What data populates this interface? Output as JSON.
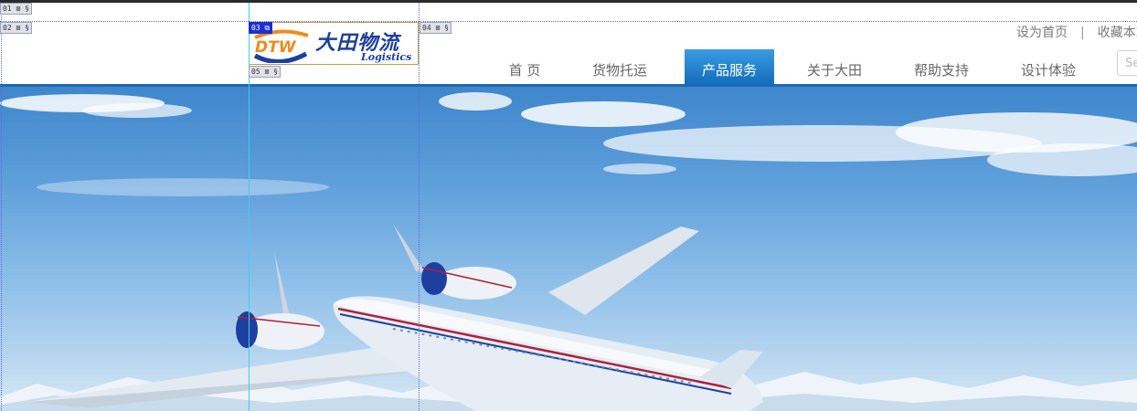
{
  "slices": {
    "s01": "01",
    "s02": "02",
    "s03": "03",
    "s04": "04",
    "s05": "05"
  },
  "logo": {
    "mark_text": "DTW",
    "cn_text": "大田物流",
    "en_text": "Logistics"
  },
  "toplinks": {
    "set_homepage": "设为首页",
    "separator": "|",
    "bookmark": "收藏本站"
  },
  "nav": {
    "items": [
      {
        "label": "首 页"
      },
      {
        "label": "货物托运"
      },
      {
        "label": "产品服务"
      },
      {
        "label": "关于大田"
      },
      {
        "label": "帮助支持"
      },
      {
        "label": "设计体验"
      }
    ],
    "active_index": 2
  },
  "search": {
    "placeholder": "Se"
  },
  "colors": {
    "brand_blue": "#1d3f9e",
    "brand_orange": "#f08a1d",
    "nav_active": "#1a78c8",
    "header_line": "#1e67b5"
  }
}
